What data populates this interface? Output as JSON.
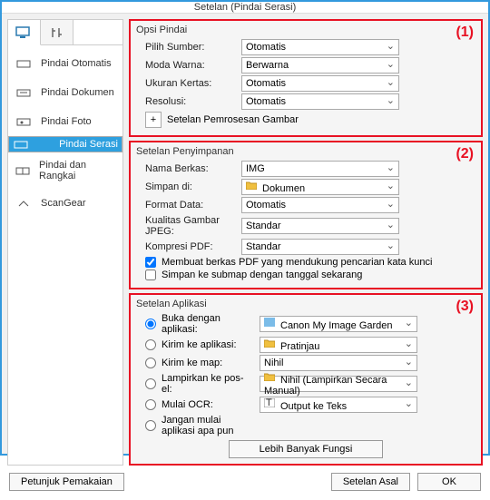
{
  "window": {
    "title": "Setelan (Pindai Serasi)"
  },
  "sidebar": {
    "items": [
      {
        "label": "Pindai Otomatis"
      },
      {
        "label": "Pindai Dokumen"
      },
      {
        "label": "Pindai Foto"
      },
      {
        "label": "Pindai Serasi"
      },
      {
        "label": "Pindai dan Rangkai"
      },
      {
        "label": "ScanGear"
      }
    ]
  },
  "groups": {
    "g1": {
      "title": "Opsi Pindai",
      "marker": "(1)",
      "source_label": "Pilih Sumber:",
      "source_value": "Otomatis",
      "color_label": "Moda Warna:",
      "color_value": "Berwarna",
      "paper_label": "Ukuran Kertas:",
      "paper_value": "Otomatis",
      "res_label": "Resolusi:",
      "res_value": "Otomatis",
      "proc_label": "Setelan Pemrosesan Gambar"
    },
    "g2": {
      "title": "Setelan Penyimpanan",
      "marker": "(2)",
      "name_label": "Nama Berkas:",
      "name_value": "IMG",
      "save_label": "Simpan di:",
      "save_value": "Dokumen",
      "fmt_label": "Format Data:",
      "fmt_value": "Otomatis",
      "jpeg_label": "Kualitas Gambar JPEG:",
      "jpeg_value": "Standar",
      "pdf_label": "Kompresi PDF:",
      "pdf_value": "Standar",
      "chk1": "Membuat berkas PDF yang mendukung pencarian kata kunci",
      "chk2": "Simpan ke submap dengan tanggal sekarang"
    },
    "g3": {
      "title": "Setelan Aplikasi",
      "marker": "(3)",
      "r1": "Buka dengan aplikasi:",
      "v1": "Canon My Image Garden",
      "r2": "Kirim ke aplikasi:",
      "v2": "Pratinjau",
      "r3": "Kirim ke map:",
      "v3": "Nihil",
      "r4": "Lampirkan ke pos-el:",
      "v4": "Nihil (Lampirkan Secara Manual)",
      "r5": "Mulai OCR:",
      "v5": "Output ke Teks",
      "r6": "Jangan mulai aplikasi apa pun",
      "more": "Lebih Banyak Fungsi"
    }
  },
  "footer": {
    "instructions": "Petunjuk Pemakaian",
    "defaults": "Setelan Asal",
    "ok": "OK"
  }
}
